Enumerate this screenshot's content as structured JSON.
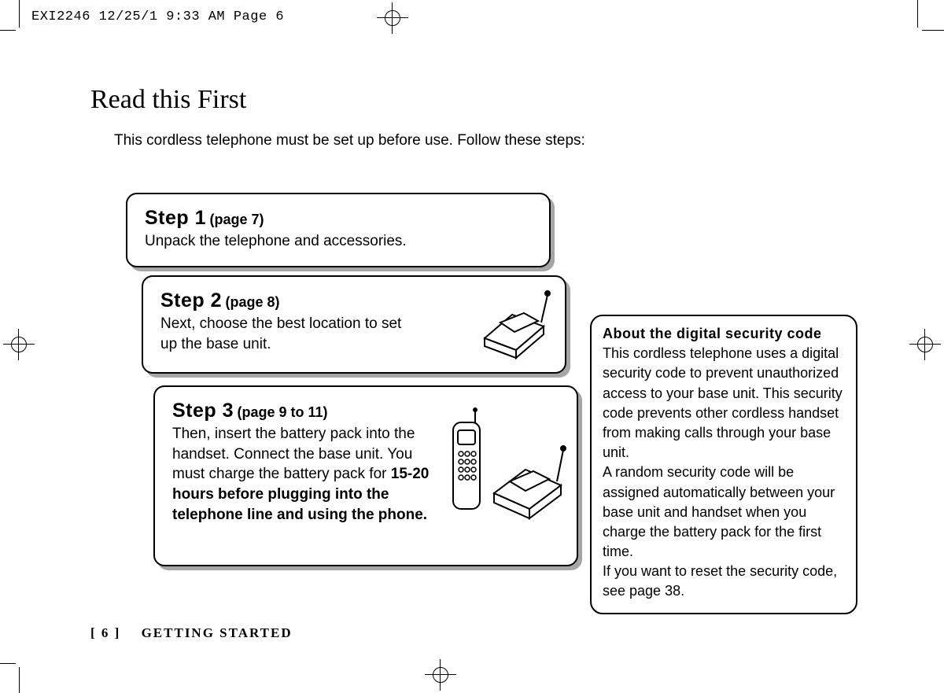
{
  "header": "EXI2246  12/25/1 9:33 AM  Page 6",
  "title": "Read this First",
  "intro": "This cordless telephone must be set up before use. Follow these steps:",
  "steps": {
    "s1": {
      "num": "Step 1",
      "page": "(page 7)",
      "body": "Unpack the telephone and accessories."
    },
    "s2": {
      "num": "Step 2",
      "page": "(page 8)",
      "body": "Next, choose the best location to set up the base unit."
    },
    "s3": {
      "num": "Step 3",
      "page": "(page 9 to 11)",
      "body_plain": "Then, insert the battery pack into the handset. Connect the base unit. You must charge the battery pack for ",
      "body_bold": "15-20 hours before plugging into the telephone line and using the phone."
    }
  },
  "sidebar": {
    "title": "About the digital security code",
    "p1": "This cordless telephone uses a digital security code to prevent unauthorized access to your base unit. This security code prevents other cordless handset from making calls through your base unit.",
    "p2": "A random security code will be assigned automatically between your base unit and handset when you charge the battery pack for the first time.",
    "p3": "If you want to reset the security code, see page 38."
  },
  "footer": {
    "page_label": "[ 6 ]",
    "section": "GETTING STARTED"
  }
}
